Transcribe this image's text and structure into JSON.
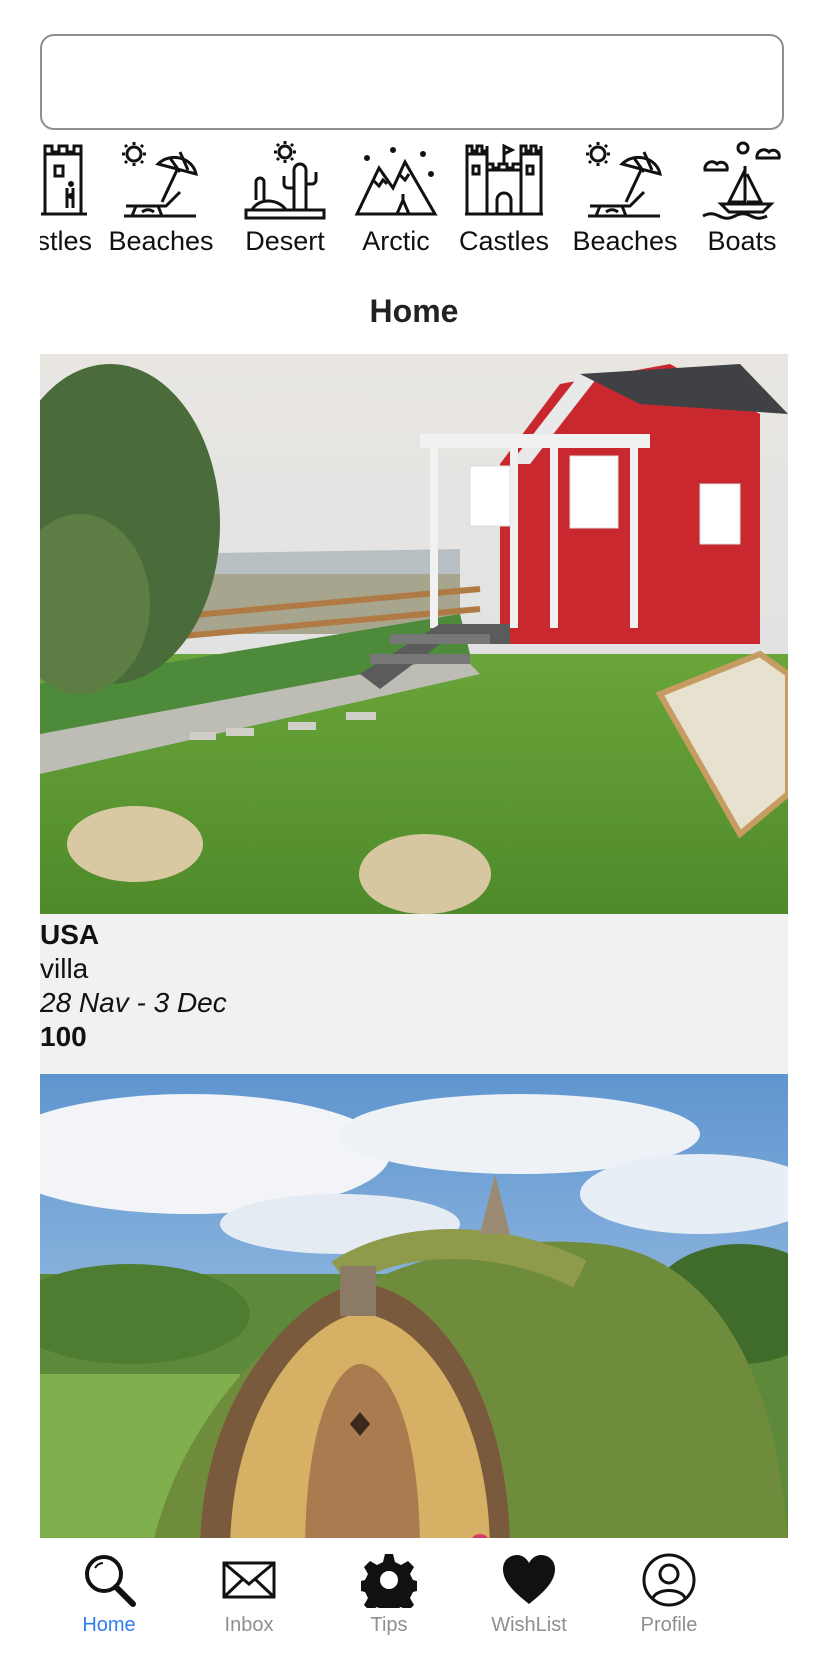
{
  "search": {
    "placeholder": ""
  },
  "categories": [
    {
      "label": "stles",
      "icon": "castle-icon"
    },
    {
      "label": "Beaches",
      "icon": "beach-umbrella-icon"
    },
    {
      "label": "Desert",
      "icon": "desert-cactus-icon"
    },
    {
      "label": "Arctic",
      "icon": "mountains-icon"
    },
    {
      "label": "Castles",
      "icon": "castle-icon"
    },
    {
      "label": "Beaches",
      "icon": "beach-umbrella-icon"
    },
    {
      "label": "Boats",
      "icon": "sailboat-icon"
    }
  ],
  "page": {
    "title": "Home"
  },
  "listings": [
    {
      "country": "USA",
      "type": "villa",
      "dates": "28 Nav - 3 Dec",
      "price": "100",
      "image": "red-tiny-house-photo"
    },
    {
      "image": "hobbit-house-photo"
    }
  ],
  "tabbar": {
    "active": "Home",
    "items": [
      {
        "label": "Home",
        "icon": "search-icon"
      },
      {
        "label": "Inbox",
        "icon": "envelope-icon"
      },
      {
        "label": "Tips",
        "icon": "gear-icon"
      },
      {
        "label": "WishList",
        "icon": "heart-icon"
      },
      {
        "label": "Profile",
        "icon": "user-icon"
      }
    ]
  },
  "colors": {
    "accent": "#2f7ef0",
    "inactive": "#8e8e93",
    "card_bg": "#f1f1f1"
  }
}
